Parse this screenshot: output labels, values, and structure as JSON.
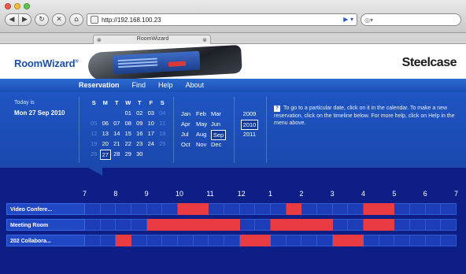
{
  "browser": {
    "url": "http://192.168.100.23",
    "tab_title": "RoomWizard",
    "back_icon": "back-arrow-icon",
    "forward_icon": "forward-arrow-icon",
    "reload_icon": "reload-icon",
    "stop_icon": "stop-icon",
    "home_icon": "home-icon"
  },
  "header": {
    "logo": "RoomWizard",
    "logo_mark": "®",
    "brand": "Steelcase"
  },
  "menu": [
    "Reservation",
    "Find",
    "Help",
    "About"
  ],
  "today": {
    "label": "Today is",
    "value": "Mon 27 Sep 2010"
  },
  "calendar": {
    "weekday_headers": [
      "S",
      "M",
      "T",
      "W",
      "T",
      "F",
      "S"
    ],
    "weeks": [
      [
        "",
        "",
        "",
        "01",
        "02",
        "03",
        "04"
      ],
      [
        "05",
        "06",
        "07",
        "08",
        "09",
        "10",
        "11"
      ],
      [
        "12",
        "13",
        "14",
        "15",
        "16",
        "17",
        "18"
      ],
      [
        "19",
        "20",
        "21",
        "22",
        "23",
        "24",
        "25"
      ],
      [
        "26",
        "27",
        "28",
        "29",
        "30",
        "",
        ""
      ]
    ],
    "selected_day": "27"
  },
  "months": [
    [
      "Jan",
      "Feb",
      "Mar"
    ],
    [
      "Apr",
      "May",
      "Jun"
    ],
    [
      "Jul",
      "Aug",
      "Sep"
    ],
    [
      "Oct",
      "Nov",
      "Dec"
    ]
  ],
  "selected_month": "Sep",
  "years": [
    "2009",
    "2010",
    "2011"
  ],
  "selected_year": "2010",
  "help_text": "To go to a particular date, click on it in the calendar. To make a new reservation, click on the timeline below. For more help, click on Help in the menu above.",
  "colors": {
    "background": "#0d1f87",
    "panel": "#1f55c2",
    "reserved": "#ea3b43",
    "free": "#1c3cb8"
  },
  "timeline": {
    "hours": [
      "7",
      "8",
      "9",
      "10",
      "11",
      "12",
      "1",
      "2",
      "3",
      "4",
      "5",
      "6",
      "7"
    ],
    "rooms": [
      {
        "name": "Video Confere...",
        "busy": [
          [
            10,
            11
          ],
          [
            13.5,
            14
          ],
          [
            16,
            17
          ]
        ]
      },
      {
        "name": "Meeting Room",
        "busy": [
          [
            9,
            12
          ],
          [
            13,
            15
          ],
          [
            16,
            17
          ]
        ]
      },
      {
        "name": "202 Collabora...",
        "busy": [
          [
            8,
            8.5
          ],
          [
            12,
            13
          ],
          [
            15,
            16
          ]
        ]
      }
    ]
  }
}
